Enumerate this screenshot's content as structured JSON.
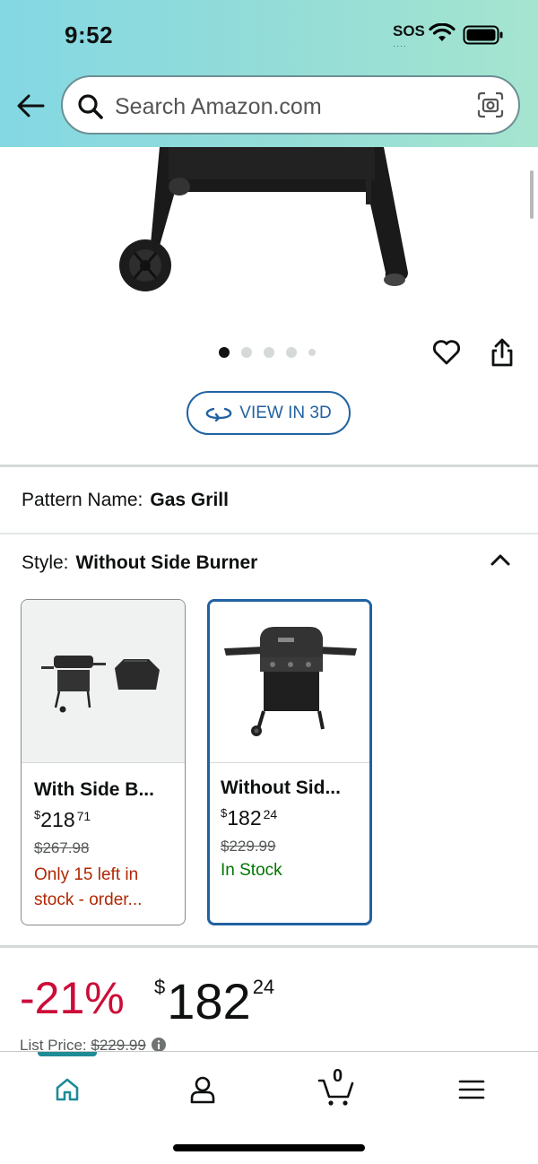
{
  "status_bar": {
    "time": "9:52",
    "carrier": "SOS",
    "carrier_dots": "····"
  },
  "search": {
    "placeholder": "Search Amazon.com"
  },
  "gallery": {
    "dot_count": 5,
    "active_index": 0
  },
  "view_3d": {
    "label": "VIEW IN 3D"
  },
  "pattern": {
    "label": "Pattern Name:",
    "value": "Gas Grill"
  },
  "style": {
    "label": "Style:",
    "value": "Without Side Burner"
  },
  "swatches": [
    {
      "title": "With Side B...",
      "currency": "$",
      "price_whole": "218",
      "price_cents": "71",
      "list_price": "$267.98",
      "stock": "Only 15 left in stock - order...",
      "stock_color": "#b12704",
      "selected": false
    },
    {
      "title": "Without Sid...",
      "currency": "$",
      "price_whole": "182",
      "price_cents": "24",
      "list_price": "$229.99",
      "stock": "In Stock",
      "stock_color": "#007600",
      "selected": true
    }
  ],
  "price": {
    "discount": "-21%",
    "currency": "$",
    "whole": "182",
    "cents": "24",
    "list_label": "List Price:",
    "list_value": "$229.99"
  },
  "bottom_nav": {
    "cart_count": "0",
    "items": [
      "home-icon",
      "account-icon",
      "cart-icon",
      "menu-icon"
    ],
    "active": "home"
  },
  "colors": {
    "accent_blue": "#2162a1",
    "discount_red": "#cc0c39",
    "stock_red": "#b12704",
    "stock_green": "#007600",
    "nav_teal": "#1e8b96"
  }
}
